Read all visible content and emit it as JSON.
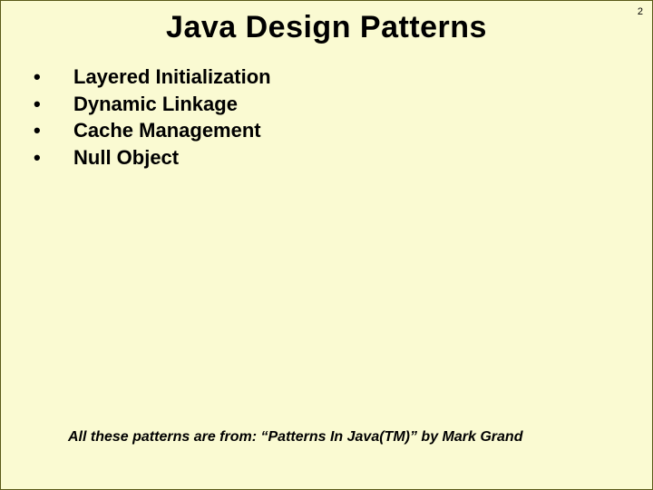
{
  "slide": {
    "page_number": "2",
    "title": "Java Design Patterns",
    "bullets": [
      "Layered Initialization",
      "Dynamic Linkage",
      "Cache Management",
      "Null Object"
    ],
    "attribution": "All these patterns are from: “Patterns In Java(TM)” by Mark Grand"
  }
}
